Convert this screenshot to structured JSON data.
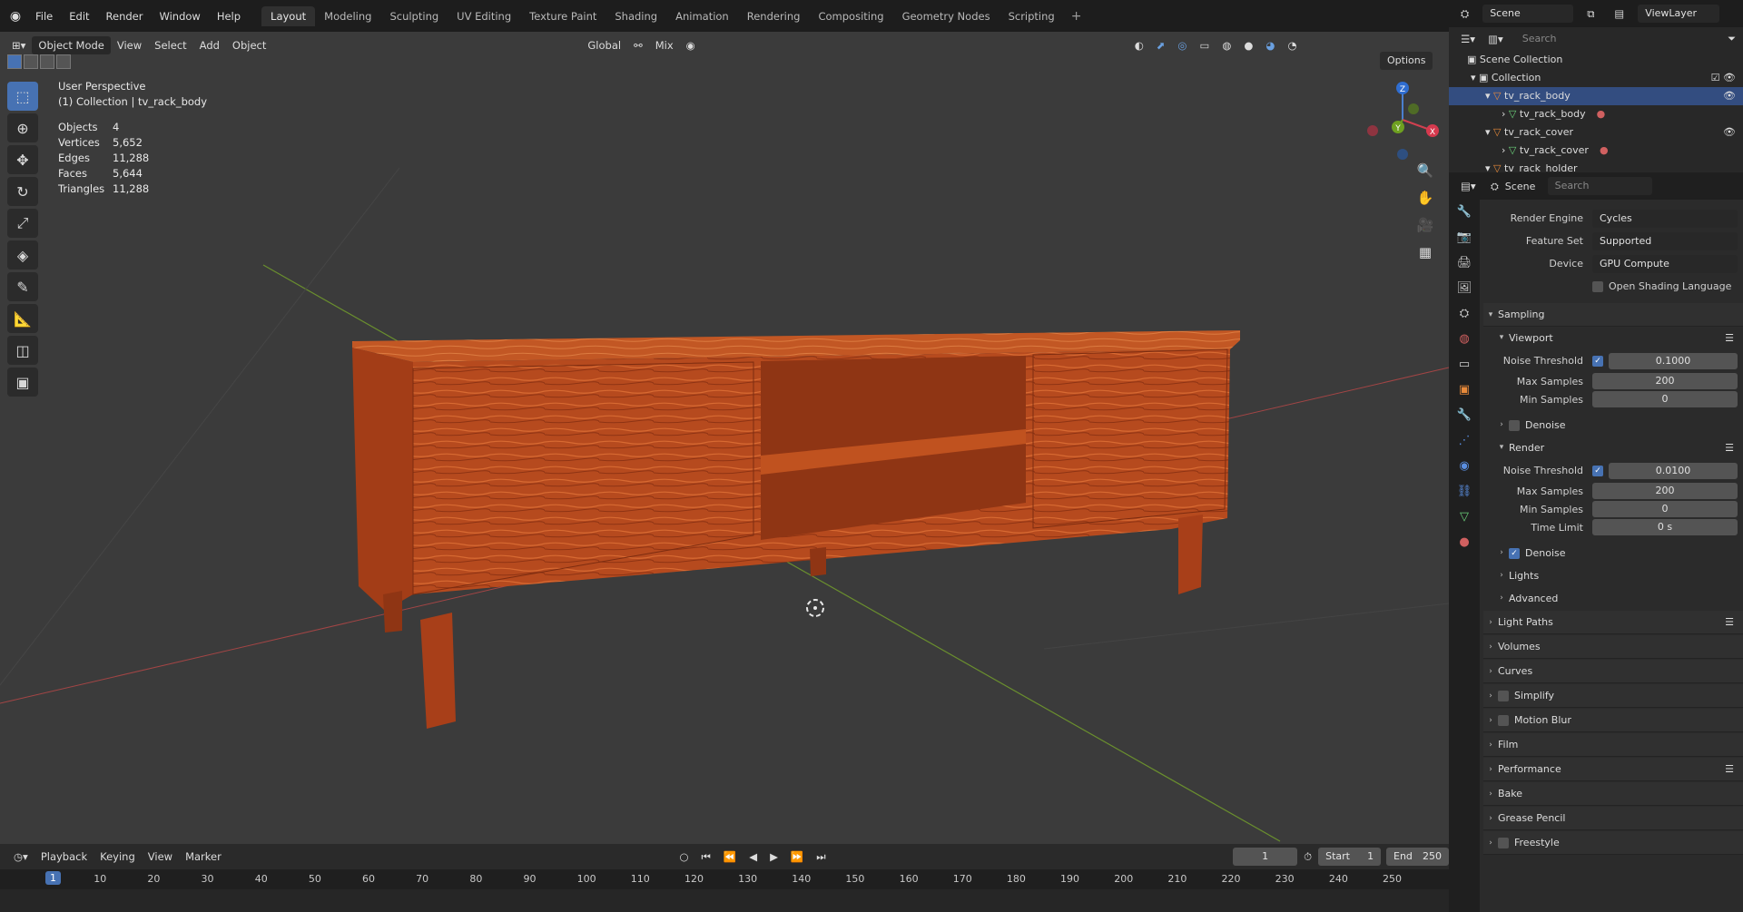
{
  "topbar": {
    "menus": [
      "File",
      "Edit",
      "Render",
      "Window",
      "Help"
    ],
    "workspaces": [
      "Layout",
      "Modeling",
      "Sculpting",
      "UV Editing",
      "Texture Paint",
      "Shading",
      "Animation",
      "Rendering",
      "Compositing",
      "Geometry Nodes",
      "Scripting"
    ],
    "active_workspace": "Layout",
    "add": "+"
  },
  "viewport": {
    "mode": "Object Mode",
    "menus": [
      "View",
      "Select",
      "Add",
      "Object"
    ],
    "orientation": "Global",
    "snap": "Mix",
    "options": "Options",
    "perspective": "User Perspective",
    "collection": "(1) Collection | tv_rack_body",
    "stats": [
      {
        "label": "Objects",
        "value": "4"
      },
      {
        "label": "Vertices",
        "value": "5,652"
      },
      {
        "label": "Edges",
        "value": "11,288"
      },
      {
        "label": "Faces",
        "value": "5,644"
      },
      {
        "label": "Triangles",
        "value": "11,288"
      }
    ],
    "gizmo": {
      "x": "X",
      "y": "Y",
      "z": "Z"
    }
  },
  "timeline": {
    "menus": [
      "Playback",
      "Keying",
      "View",
      "Marker"
    ],
    "current_frame": "1",
    "start_label": "Start",
    "start": "1",
    "end_label": "End",
    "end": "250",
    "ticks": [
      "1",
      "10",
      "20",
      "30",
      "40",
      "50",
      "60",
      "70",
      "80",
      "90",
      "100",
      "110",
      "120",
      "130",
      "140",
      "150",
      "160",
      "170",
      "180",
      "190",
      "200",
      "210",
      "220",
      "230",
      "240",
      "250"
    ]
  },
  "right": {
    "scene": "Scene",
    "view_layer": "ViewLayer",
    "search_placeholder": "Search",
    "outliner": [
      {
        "label": "Scene Collection",
        "indent": 0
      },
      {
        "label": "Collection",
        "indent": 1
      },
      {
        "label": "tv_rack_body",
        "indent": 2,
        "selected": true
      },
      {
        "label": "tv_rack_body",
        "indent": 3
      },
      {
        "label": "tv_rack_cover",
        "indent": 2
      },
      {
        "label": "tv_rack_cover",
        "indent": 3
      },
      {
        "label": "tv_rack_holder",
        "indent": 2
      }
    ],
    "props": {
      "context": "Scene",
      "render_engine_label": "Render Engine",
      "render_engine": "Cycles",
      "feature_set_label": "Feature Set",
      "feature_set": "Supported",
      "device_label": "Device",
      "device": "GPU Compute",
      "osl": "Open Shading Language",
      "sampling": "Sampling",
      "viewport": "Viewport",
      "noise_threshold_label": "Noise Threshold",
      "vp_noise": "0.1000",
      "max_samples_label": "Max Samples",
      "vp_max": "200",
      "min_samples_label": "Min Samples",
      "vp_min": "0",
      "denoise": "Denoise",
      "render": "Render",
      "r_noise": "0.0100",
      "r_max": "200",
      "r_min": "0",
      "time_limit_label": "Time Limit",
      "time_limit": "0 s",
      "lights": "Lights",
      "advanced": "Advanced",
      "panels": [
        "Light Paths",
        "Volumes",
        "Curves",
        "Simplify",
        "Motion Blur",
        "Film",
        "Performance",
        "Bake",
        "Grease Pencil",
        "Freestyle"
      ]
    }
  },
  "colors": {
    "accent": "#4772b3",
    "viewport_bg": "#3b3b3b",
    "wood": "#b5481d"
  }
}
